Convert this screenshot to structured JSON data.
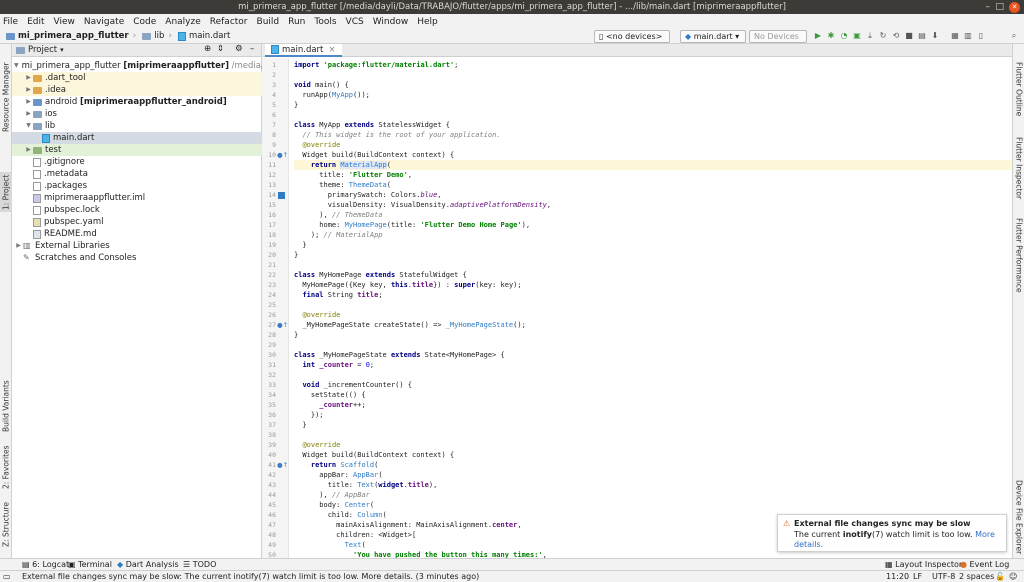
{
  "window": {
    "title": "mi_primera_app_flutter [/media/dayli/Data/TRABAJO/flutter/apps/mi_primera_app_flutter] - .../lib/main.dart [miprimeraappflutter]"
  },
  "menu": [
    "File",
    "Edit",
    "View",
    "Navigate",
    "Code",
    "Analyze",
    "Refactor",
    "Build",
    "Run",
    "Tools",
    "VCS",
    "Window",
    "Help"
  ],
  "breadcrumb": {
    "project": "mi_primera_app_flutter",
    "folder": "lib",
    "file": "main.dart"
  },
  "toolbar": {
    "device": "<no devices>",
    "run_config": "main.dart",
    "devices_label": "No Devices"
  },
  "left_tabs": {
    "resource_manager": "Resource Manager",
    "project": "1: Project",
    "build_variants": "Build Variants",
    "favorites": "2: Favorites",
    "structure": "Z: Structure"
  },
  "right_tabs": {
    "outline": "Flutter Outline",
    "inspector": "Flutter Inspector",
    "performance": "Flutter Performance",
    "device_explorer": "Device File Explorer"
  },
  "project_panel": {
    "header": "Project",
    "root_name": "mi_primera_app_flutter",
    "root_module": "[miprimeraappflutter]",
    "root_path": "/media/dayli/Data/TRABAJO/flutter/apps/mi_primera_app_flutter",
    "items": [
      {
        "label": ".dart_tool"
      },
      {
        "label": ".idea"
      },
      {
        "label": "android",
        "module": "[miprimeraappflutter_android]"
      },
      {
        "label": "ios"
      },
      {
        "label": "lib"
      },
      {
        "label": "main.dart"
      },
      {
        "label": "test"
      },
      {
        "label": ".gitignore"
      },
      {
        "label": ".metadata"
      },
      {
        "label": ".packages"
      },
      {
        "label": "miprimeraappflutter.iml"
      },
      {
        "label": "pubspec.lock"
      },
      {
        "label": "pubspec.yaml"
      },
      {
        "label": "README.md"
      },
      {
        "label": "External Libraries"
      },
      {
        "label": "Scratches and Consoles"
      }
    ]
  },
  "editor": {
    "tab": "main.dart"
  },
  "notification": {
    "title": "External file changes sync may be slow",
    "body_prefix": "The current ",
    "body_bold": "inotify",
    "body_suffix": "(7) watch limit is too low. ",
    "link": "More details."
  },
  "bottom_tabs": {
    "logcat": "6: Logcat",
    "terminal": "Terminal",
    "dart_analysis": "Dart Analysis",
    "todo": "TODO",
    "layout_inspector": "Layout Inspector",
    "event_log": "Event Log"
  },
  "status": {
    "message": "External file changes sync may be slow: The current inotify(7) watch limit is too low. More details. (3 minutes ago)",
    "position": "11:20",
    "line_sep": "LF",
    "encoding": "UTF-8",
    "indent": "2 spaces"
  }
}
